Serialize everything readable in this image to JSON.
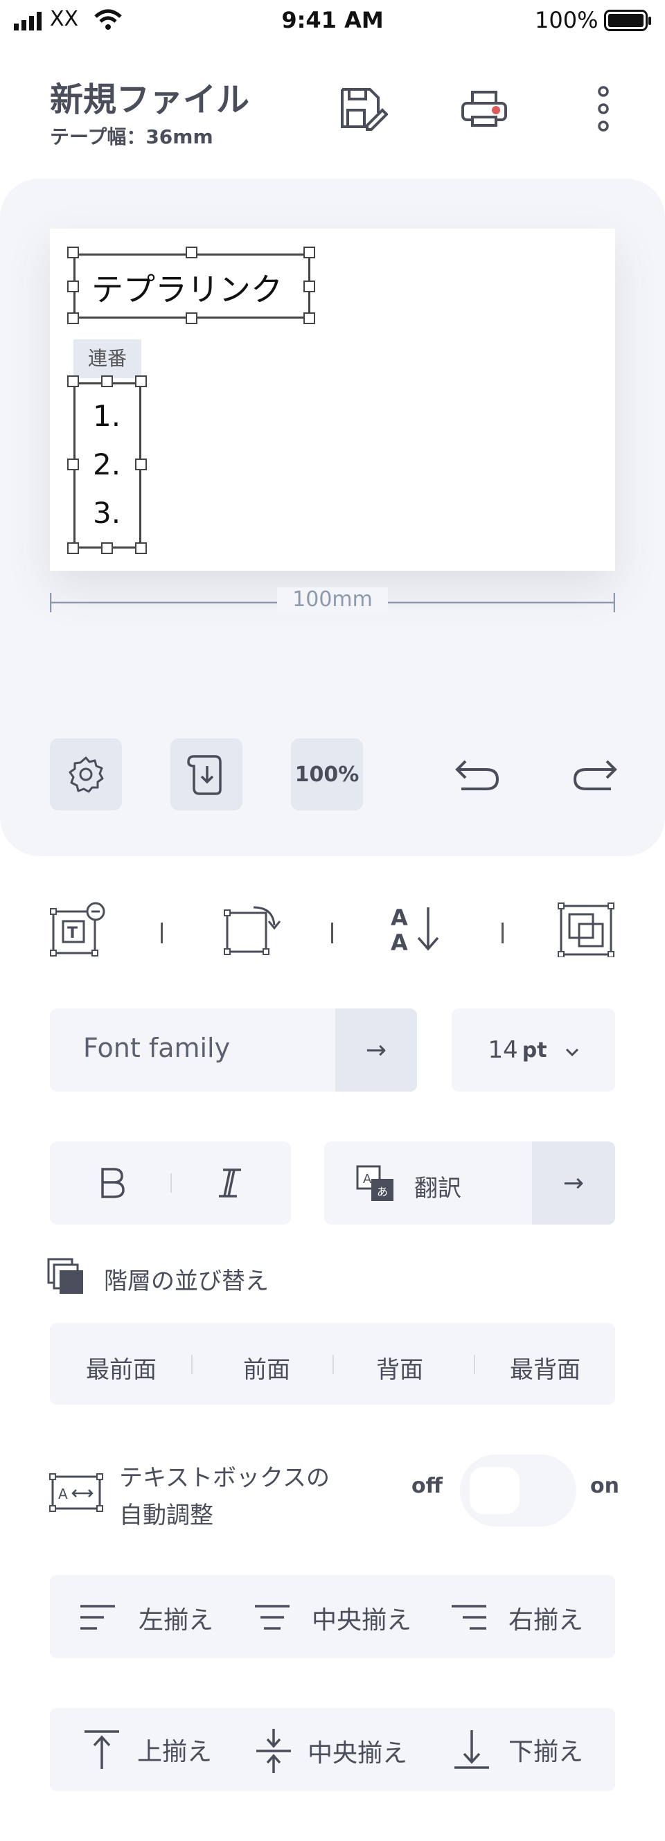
{
  "status_bar": {
    "carrier": "XX",
    "time": "9:41 AM",
    "battery": "100%"
  },
  "header": {
    "title": "新規ファイル",
    "subtitle": "テープ幅：36mm"
  },
  "canvas": {
    "text_box": "テプラリンク",
    "serial_tag": "連番",
    "serial_items": [
      "1.",
      "2.",
      "3."
    ],
    "width_label": "100mm"
  },
  "toolbar": {
    "zoom": "100%"
  },
  "font": {
    "family_placeholder": "Font family",
    "arrow": "→",
    "size_value": "14",
    "size_unit": "pt",
    "chevron": "⌄"
  },
  "style": {
    "bold": "B",
    "italic": "I",
    "translate_label": "翻訳",
    "translate_arrow": "→"
  },
  "layer": {
    "title": "階層の並び替え",
    "options": [
      "最前面",
      "前面",
      "背面",
      "最背面"
    ]
  },
  "autofit": {
    "label_line1": "テキストボックスの",
    "label_line2": "自動調整",
    "off": "off",
    "on": "on",
    "state": "off"
  },
  "h_align": {
    "left": "左揃え",
    "center": "中央揃え",
    "right": "右揃え"
  },
  "v_align": {
    "top": "上揃え",
    "middle": "中央揃え",
    "bottom": "下揃え"
  },
  "colors": {
    "accent_light": "#e3e8f1",
    "panel_bg": "#f4f5f8",
    "text": "#4a4e5a",
    "print_dot": "#e05a5a"
  }
}
